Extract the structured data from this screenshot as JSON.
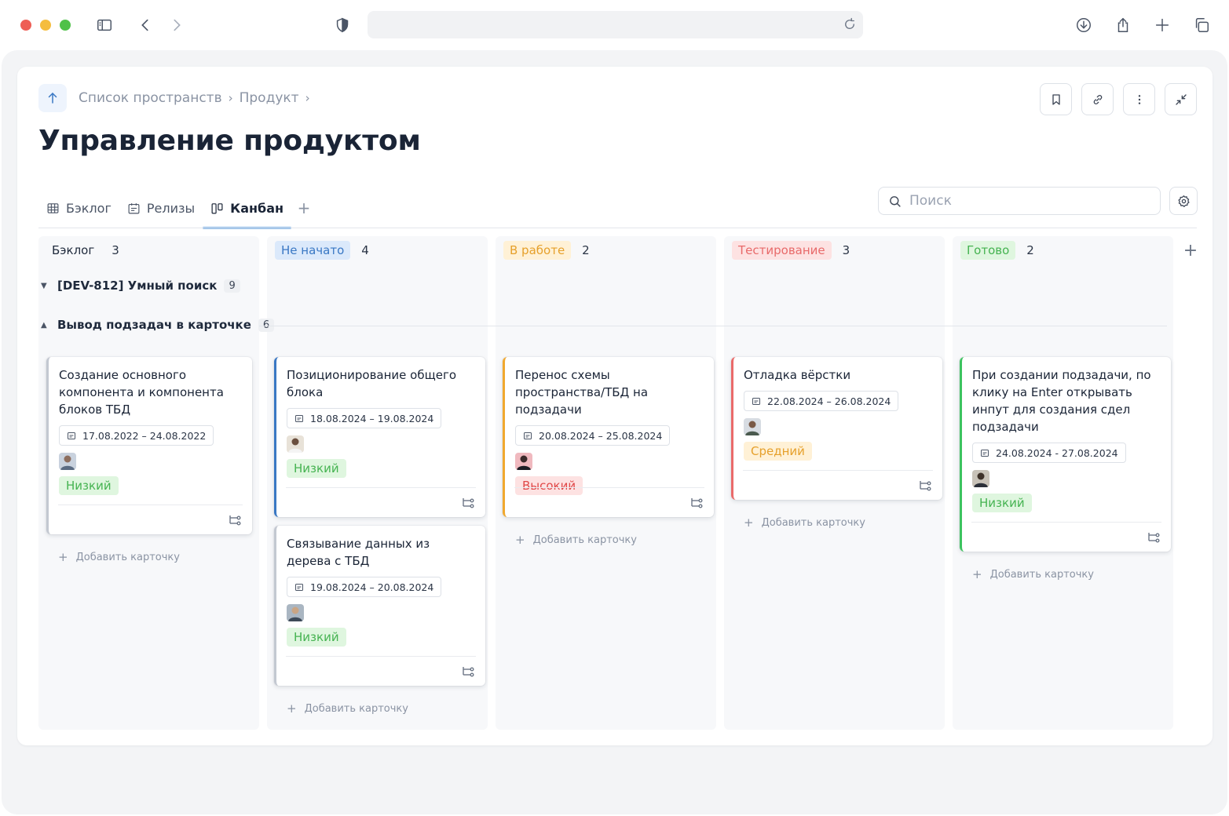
{
  "breadcrumbs": [
    "Список пространств",
    "Продукт"
  ],
  "page_title": "Управление продуктом",
  "tabs": [
    {
      "label": "Бэклог",
      "icon": "table-icon"
    },
    {
      "label": "Релизы",
      "icon": "calendar-icon"
    },
    {
      "label": "Канбан",
      "icon": "kanban-icon",
      "active": true
    }
  ],
  "search": {
    "placeholder": "Поиск"
  },
  "columns": [
    {
      "name": "Бэклог",
      "count": "3",
      "pill_bg": "transparent",
      "pill_color": "#1f2a3c"
    },
    {
      "name": "Не начато",
      "count": "4",
      "pill_bg": "#dbe9fb",
      "pill_color": "#3a78c4"
    },
    {
      "name": "В работе",
      "count": "2",
      "pill_bg": "#fff1d6",
      "pill_color": "#e6a02b"
    },
    {
      "name": "Тестирование",
      "count": "3",
      "pill_bg": "#fde2e2",
      "pill_color": "#e86a6a"
    },
    {
      "name": "Готово",
      "count": "2",
      "pill_bg": "#dff6df",
      "pill_color": "#45b351"
    }
  ],
  "groups": [
    {
      "title": "[DEV-812] Умный поиск",
      "count": "9",
      "collapsed": true
    },
    {
      "title": "Вывод подзадач в карточке",
      "count": "6",
      "collapsed": false
    }
  ],
  "cards": [
    {
      "title": "Создание основного компонента и компонента блоков ТБД",
      "date": "17.08.2022 – 24.08.2022",
      "priority": "Низкий",
      "accent": "#c3c8d1"
    },
    {
      "title": "Позиционирование общего блока",
      "date": "18.08.2024 – 19.08.2024",
      "priority": "Низкий",
      "accent": "#3a78c4"
    },
    {
      "title": "Связывание данных из дерева с ТБД",
      "date": "19.08.2024 – 20.08.2024",
      "priority": "Низкий",
      "accent": "#c3c8d1"
    },
    {
      "title": "Перенос схемы пространства/ТБД на подзадачи",
      "date": "20.08.2024 – 25.08.2024",
      "priority": "Высокий",
      "accent": "#f0a82e"
    },
    {
      "title": "Отладка вёрстки",
      "date": "22.08.2024 – 26.08.2024",
      "priority": "Средний",
      "accent": "#ea6a6a"
    },
    {
      "title": "При создании подзадачи, по клику на Enter открывать инпут для создания сдел подзадачи",
      "date": "24.08.2024 - 27.08.2024",
      "priority": "Низкий",
      "accent": "#3cc35f"
    }
  ],
  "add_card_label": "Добавить карточку"
}
